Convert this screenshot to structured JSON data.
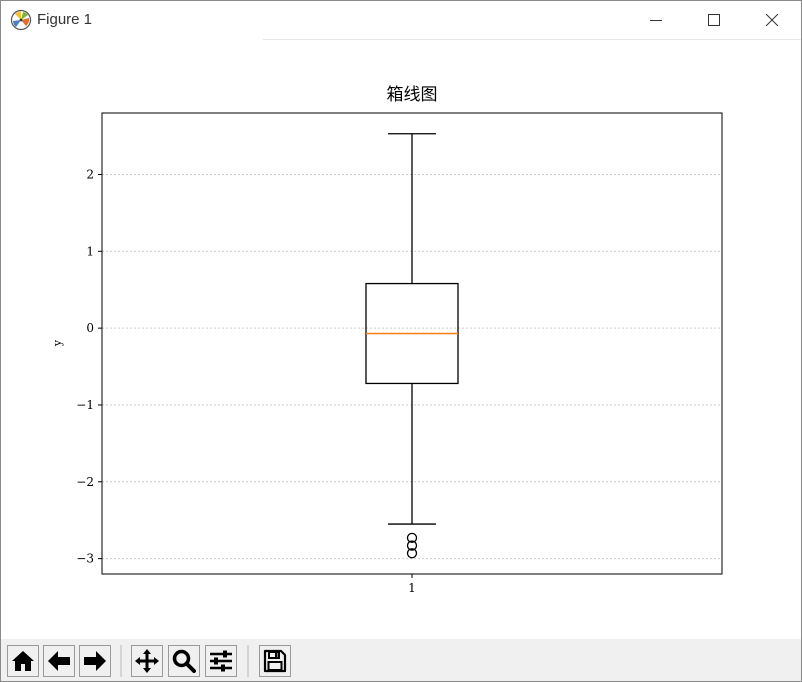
{
  "window": {
    "title": "Figure 1"
  },
  "chart_data": {
    "type": "boxplot",
    "title": "箱线图",
    "xlabel": "",
    "ylabel": "y",
    "categories": [
      "1"
    ],
    "ylim": [
      -3.2,
      2.8
    ],
    "yticks": [
      {
        "value": -3,
        "label": "−3"
      },
      {
        "value": -2,
        "label": "−2"
      },
      {
        "value": -1,
        "label": "−1"
      },
      {
        "value": 0,
        "label": "0"
      },
      {
        "value": 1,
        "label": "1"
      },
      {
        "value": 2,
        "label": "2"
      }
    ],
    "grid": "y-dotted",
    "boxes": [
      {
        "category": "1",
        "whisker_low": -2.55,
        "q1": -0.72,
        "median": -0.07,
        "q3": 0.58,
        "whisker_high": 2.53,
        "outliers": [
          -2.73,
          -2.83,
          -2.93
        ]
      }
    ],
    "colors": {
      "box": "#000000",
      "median": "#ff7f0e",
      "grid": "#cccccc"
    }
  },
  "toolbar": {
    "buttons": [
      {
        "name": "home-button",
        "icon": "home-icon"
      },
      {
        "name": "back-button",
        "icon": "arrow-left-icon"
      },
      {
        "name": "forward-button",
        "icon": "arrow-right-icon"
      },
      {
        "name": "pan-button",
        "icon": "move-icon"
      },
      {
        "name": "zoom-button",
        "icon": "magnifier-icon"
      },
      {
        "name": "configure-subplots-button",
        "icon": "sliders-icon"
      },
      {
        "name": "save-button",
        "icon": "floppy-disk-icon"
      }
    ]
  }
}
